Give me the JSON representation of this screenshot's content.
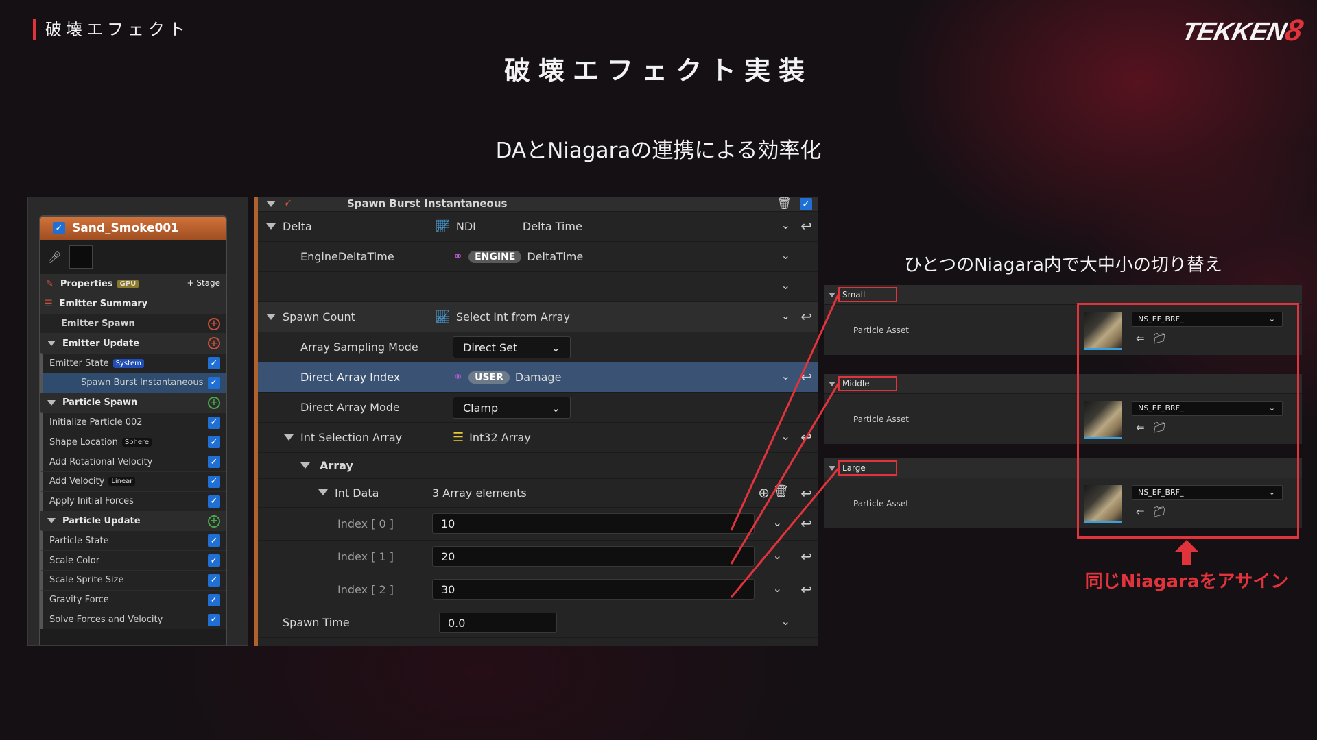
{
  "header": {
    "section_tag": "破壊エフェクト",
    "logo_text": "TEKKEN",
    "logo_number": "8",
    "title": "破壊エフェクト実装",
    "subtitle": "DAとNiagaraの連携による効率化"
  },
  "captions": {
    "right": "ひとつのNiagara内で大中小の切り替え",
    "assign": "同じNiagaraをアサイン"
  },
  "colors": {
    "accent": "#e0333c",
    "emitter_header": "#c86630",
    "selection": "#3a5374",
    "checkbox": "#1f6fd4"
  },
  "emitter": {
    "name": "Sand_Smoke001",
    "rows": [
      {
        "label": "Properties",
        "badge": "GPU",
        "extra": "+ Stage",
        "type": "properties"
      },
      {
        "label": "Emitter Summary",
        "type": "group"
      },
      {
        "label": "Emitter Spawn",
        "type": "sub",
        "icon": "add-red"
      },
      {
        "label": "Emitter Update",
        "type": "group-tri",
        "icon": "add-red"
      },
      {
        "label": "Emitter State",
        "badge": "System",
        "type": "item",
        "check": true
      },
      {
        "label": "Spawn Burst Instantaneous",
        "type": "item-selected",
        "check": true
      },
      {
        "label": "Particle Spawn",
        "type": "group-tri",
        "icon": "add-green"
      },
      {
        "label": "Initialize Particle 002",
        "type": "item",
        "check": true
      },
      {
        "label": "Shape Location",
        "badge": "Sphere",
        "type": "item",
        "check": true
      },
      {
        "label": "Add Rotational Velocity",
        "type": "item",
        "check": true
      },
      {
        "label": "Add Velocity",
        "badge": "Linear",
        "type": "item",
        "check": true
      },
      {
        "label": "Apply Initial Forces",
        "type": "item",
        "check": true
      },
      {
        "label": "Particle Update",
        "type": "group-tri",
        "icon": "add-green"
      },
      {
        "label": "Particle State",
        "type": "item",
        "check": true
      },
      {
        "label": "Scale Color",
        "type": "item",
        "check": true
      },
      {
        "label": "Scale Sprite Size",
        "type": "item",
        "check": true
      },
      {
        "label": "Gravity Force",
        "type": "item",
        "check": true
      },
      {
        "label": "Solve Forces and Velocity",
        "type": "item",
        "check": true
      }
    ]
  },
  "details": {
    "module_title": "Spawn Burst Instantaneous",
    "delta": {
      "label": "Delta",
      "source": "NDI",
      "value": "Delta Time"
    },
    "engine_delta": {
      "label": "EngineDeltaTime",
      "pill": "ENGINE",
      "value": "DeltaTime"
    },
    "spawn_count": {
      "label": "Spawn Count",
      "value": "Select Int from Array"
    },
    "array_sampling_mode": {
      "label": "Array Sampling Mode",
      "value": "Direct Set"
    },
    "direct_array_index": {
      "label": "Direct Array Index",
      "pill": "USER",
      "value": "Damage"
    },
    "direct_array_mode": {
      "label": "Direct Array Mode",
      "value": "Clamp"
    },
    "int_selection_array": {
      "label": "Int Selection Array",
      "value": "Int32 Array"
    },
    "array": {
      "label": "Array"
    },
    "int_data": {
      "label": "Int Data",
      "value": "3 Array elements"
    },
    "indices": [
      {
        "label": "Index [ 0 ]",
        "value": "10"
      },
      {
        "label": "Index [ 1 ]",
        "value": "20"
      },
      {
        "label": "Index [ 2 ]",
        "value": "30"
      }
    ],
    "spawn_time": {
      "label": "Spawn Time",
      "value": "0.0"
    }
  },
  "assets": [
    {
      "section": "Small",
      "label": "Particle Asset",
      "value": "NS_EF_BRF_"
    },
    {
      "section": "Middle",
      "label": "Particle Asset",
      "value": "NS_EF_BRF_"
    },
    {
      "section": "Large",
      "label": "Particle Asset",
      "value": "NS_EF_BRF_"
    }
  ]
}
